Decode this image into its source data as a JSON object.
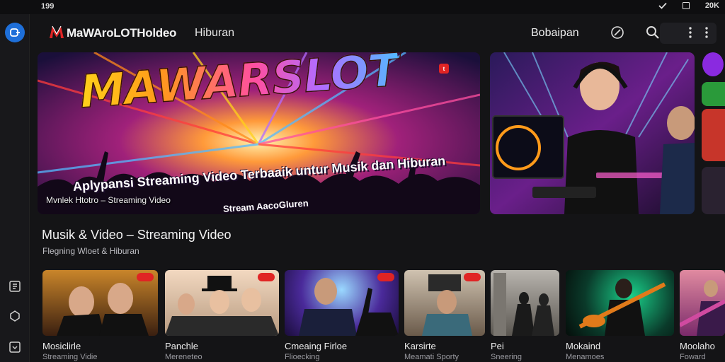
{
  "status_bar": {
    "time": "199",
    "right_text": "20K"
  },
  "header": {
    "app_title": "MaWAroLOTHoldeo",
    "subtitle": "Hiburan",
    "link": "Bobaipan"
  },
  "hero": {
    "title": "MAWARSLOT",
    "tagline": "Aplypansi Streaming Video Terbaaik untur Musik dan Hiburan",
    "tagline_2": "Stream AacoGluren",
    "caption": "Mvnlek Htotro – Streaming Video",
    "badge": "t"
  },
  "section": {
    "title": "Musik & Video – Streaming Video",
    "subtitle": "Flegning Wloet & Hiburan"
  },
  "thumbnails": [
    {
      "title": "Mosiclirle",
      "sub": "Streaming Vidie",
      "live": true
    },
    {
      "title": "Panchle",
      "sub": "Mereneteo",
      "live": true
    },
    {
      "title": "Cmeaing Firloe",
      "sub": "Flioecking",
      "live": true
    },
    {
      "title": "Karsirte",
      "sub": "Meamati Sporty",
      "live": true
    },
    {
      "title": "Pei",
      "sub": "Sneering",
      "live": false
    },
    {
      "title": "Mokaind",
      "sub": "Menamoes",
      "live": false
    },
    {
      "title": "Moolaho",
      "sub": "Foward",
      "live": false
    }
  ],
  "colors": {
    "accent": "#1e6fd9",
    "live": "#e02424",
    "background": "#141416"
  },
  "icons": [
    "account-icon",
    "pen-icon",
    "search-icon",
    "more-vert-icon",
    "library-icon",
    "explore-icon",
    "downloads-icon"
  ]
}
